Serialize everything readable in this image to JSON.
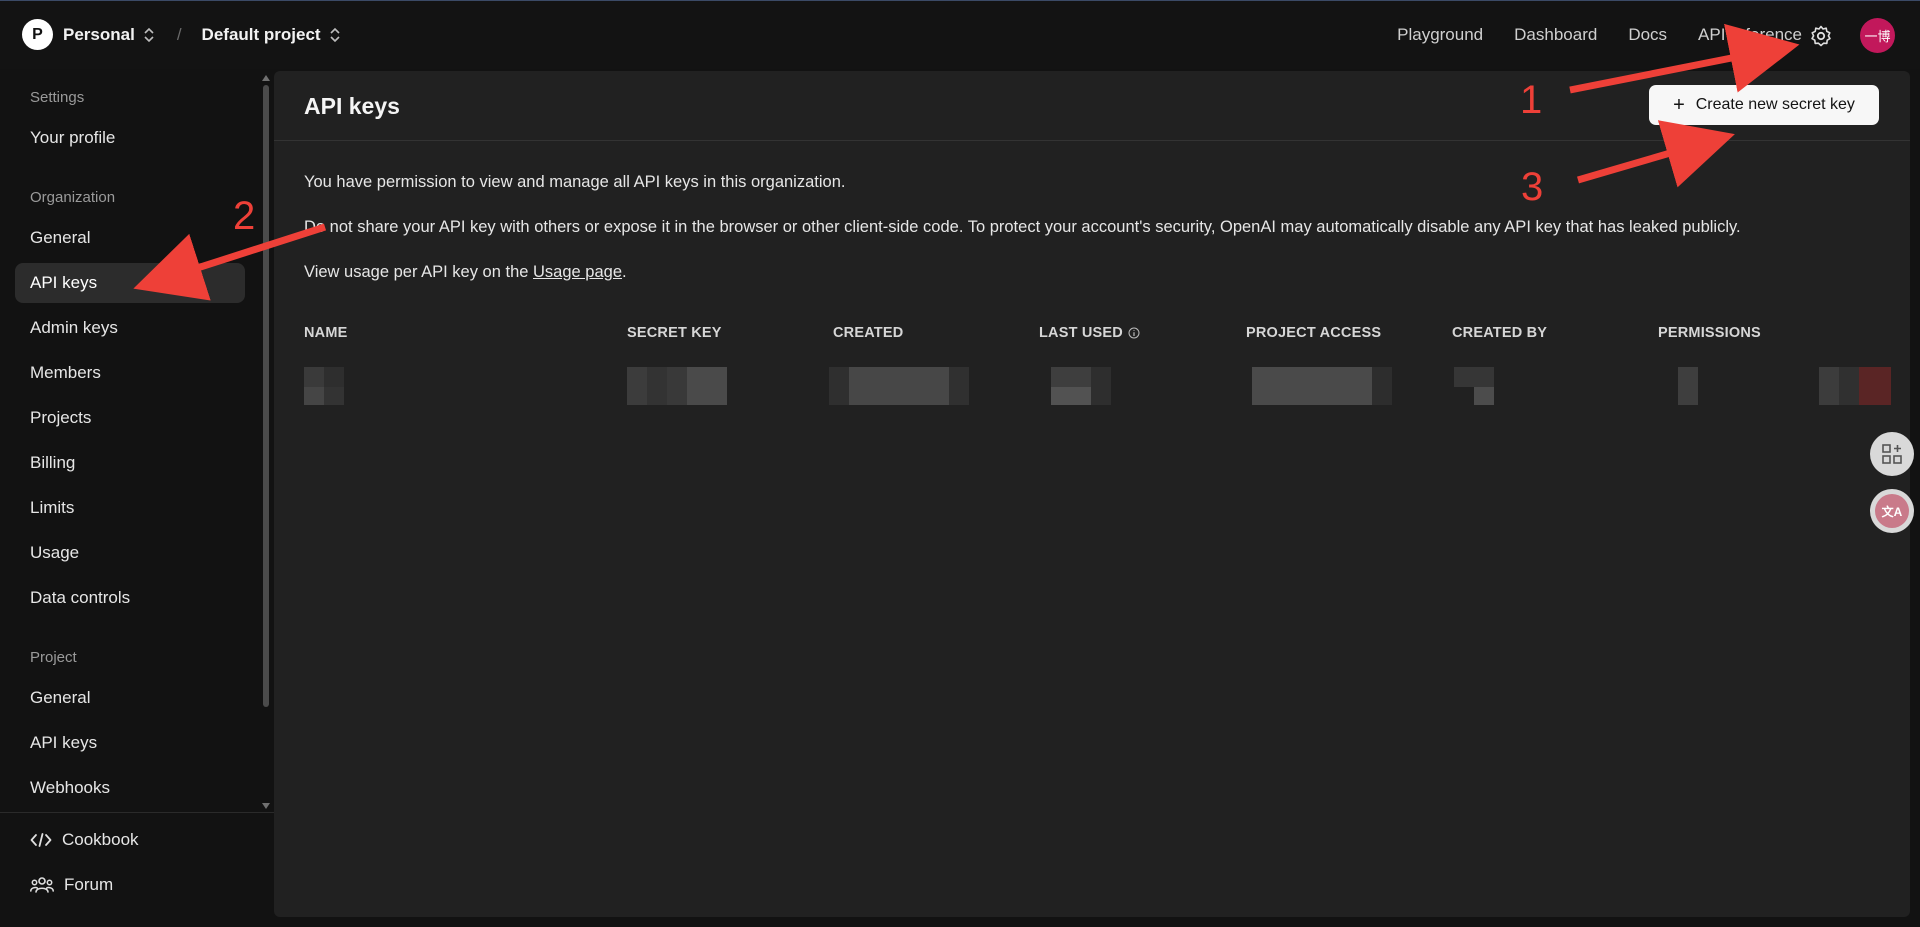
{
  "topbar": {
    "org_initial": "P",
    "org_name": "Personal",
    "project_name": "Default project",
    "separator": "/",
    "nav": [
      "Playground",
      "Dashboard",
      "Docs",
      "API reference"
    ],
    "avatar_text": "一博",
    "avatar_color": "#c2185b"
  },
  "sidebar": {
    "settings_heading": "Settings",
    "your_profile": "Your profile",
    "org_heading": "Organization",
    "org_items": [
      "General",
      "API keys",
      "Admin keys",
      "Members",
      "Projects",
      "Billing",
      "Limits",
      "Usage",
      "Data controls"
    ],
    "active_item": "API keys",
    "project_heading": "Project",
    "project_items": [
      "General",
      "API keys",
      "Webhooks"
    ],
    "cookbook": "Cookbook",
    "forum": "Forum"
  },
  "main": {
    "title": "API keys",
    "create_button": "Create new secret key",
    "permission_text": "You have permission to view and manage all API keys in this organization.",
    "warning_text": "Do not share your API key with others or expose it in the browser or other client-side code. To protect your account's security, OpenAI may automatically disable any API key that has leaked publicly.",
    "usage_prefix": "View usage per API key on the ",
    "usage_link": "Usage page",
    "usage_suffix": ".",
    "columns": [
      "NAME",
      "SECRET KEY",
      "CREATED",
      "LAST USED",
      "PROJECT ACCESS",
      "CREATED BY",
      "PERMISSIONS"
    ]
  },
  "annotations": {
    "labels": [
      "1",
      "2",
      "3"
    ],
    "arrow_color": "#ee4038"
  },
  "colors": {
    "background": "#121212",
    "panel": "#212121",
    "button_bg": "#f7f7f7"
  }
}
